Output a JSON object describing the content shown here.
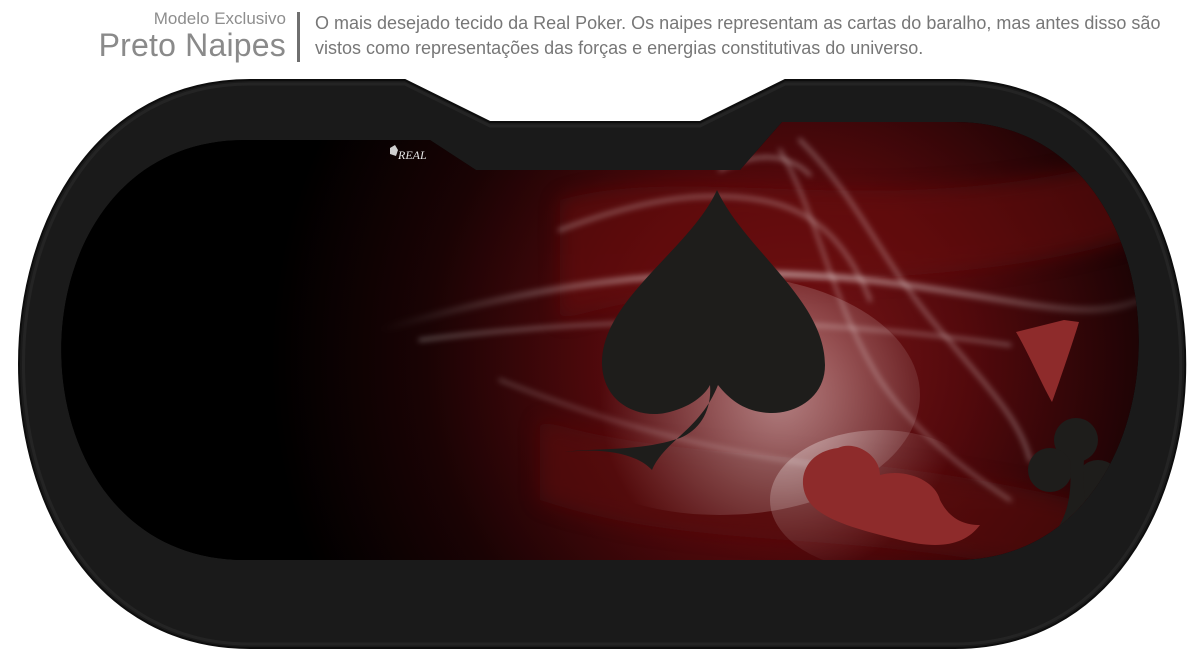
{
  "header": {
    "model_subtitle": "Modelo Exclusivo",
    "model_title": "Preto Naipes",
    "description": "O mais desejado tecido da Real Poker. Os naipes representam as cartas do baralho, mas antes disso são vistos como representações das forças e energias constitutivas do universo."
  },
  "table": {
    "brand_logo_text": "REAL",
    "rail_color": "#1c1c1c",
    "felt_color": "#000000",
    "accent_red": "#8e2b2b",
    "suit_icons": [
      "spade-icon",
      "diamond-icon",
      "heart-icon",
      "club-icon"
    ]
  }
}
